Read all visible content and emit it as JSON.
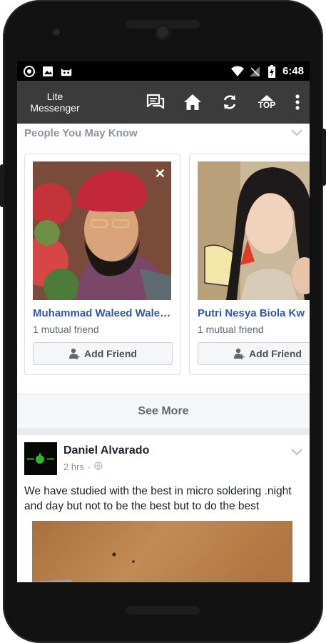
{
  "status_bar": {
    "time": "6:48",
    "left_icons": [
      "camera-lens-icon",
      "image-icon",
      "android-robot-icon"
    ],
    "right_icons": [
      "wifi-icon",
      "no-signal-icon",
      "battery-charging-icon"
    ]
  },
  "app_bar": {
    "title_line1": "Lite",
    "title_line2": "Messenger",
    "actions": [
      "messages-icon",
      "home-icon",
      "refresh-icon",
      "top-icon",
      "more-icon"
    ],
    "top_label": "TOP"
  },
  "pymk": {
    "header": "People You May Know",
    "cards": [
      {
        "name": "Muhammad Waleed Wale…",
        "mutual": "1 mutual friend",
        "button": "Add Friend"
      },
      {
        "name": "Putri Nesya Biola Kw",
        "mutual": "1 mutual friend",
        "button": "Add Friend"
      }
    ],
    "see_more": "See More"
  },
  "post": {
    "author": "Daniel Alvarado",
    "time": "2 hrs",
    "privacy_icon": "globe-icon",
    "text": "We have studied with the best in micro soldering .night and day but not to be the best but to do the best"
  },
  "colors": {
    "app_bar": "#3b3b3b",
    "link_blue": "#365899",
    "feed_bg": "#e9ebee"
  }
}
